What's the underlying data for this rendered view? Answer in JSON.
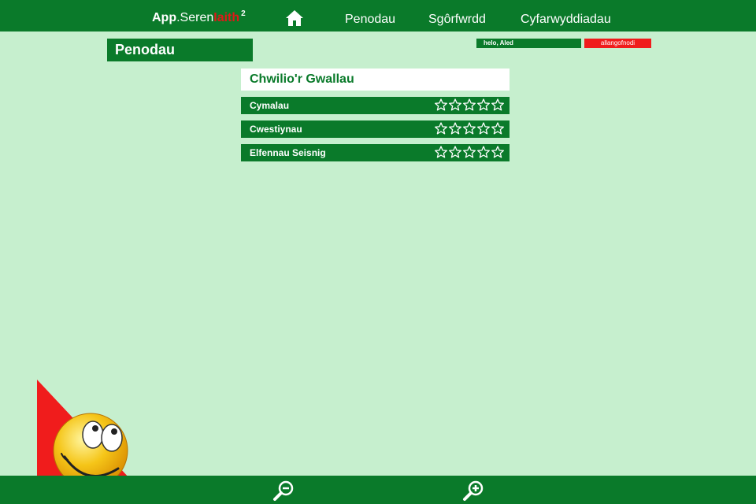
{
  "header": {
    "brand": {
      "part1": "App",
      "part2": ".Seren",
      "part3": "Iaith",
      "part4": "2"
    },
    "nav": [
      {
        "label": "Penodau"
      },
      {
        "label": "Sgôrfwrdd"
      },
      {
        "label": "Cyfarwyddiadau"
      }
    ],
    "home_icon": "home-icon"
  },
  "page": {
    "heading": "Penodau"
  },
  "user": {
    "greeting": "helo, Aled",
    "logout_label": "allangofnodi"
  },
  "section": {
    "title": "Chwilio'r Gwallau",
    "items": [
      {
        "label": "Cymalau",
        "stars_filled": 0,
        "stars_total": 5
      },
      {
        "label": "Cwestiynau",
        "stars_filled": 0,
        "stars_total": 5
      },
      {
        "label": "Elfennau Seisnig",
        "stars_filled": 0,
        "stars_total": 5
      }
    ]
  },
  "footer": {
    "zoom_out_icon": "zoom-out-icon",
    "zoom_in_icon": "zoom-in-icon"
  },
  "colors": {
    "primary_green": "#0a7a2a",
    "background": "#c6efce",
    "accent_red": "#f01c1c",
    "mascot_yellow": "#f5c518"
  }
}
